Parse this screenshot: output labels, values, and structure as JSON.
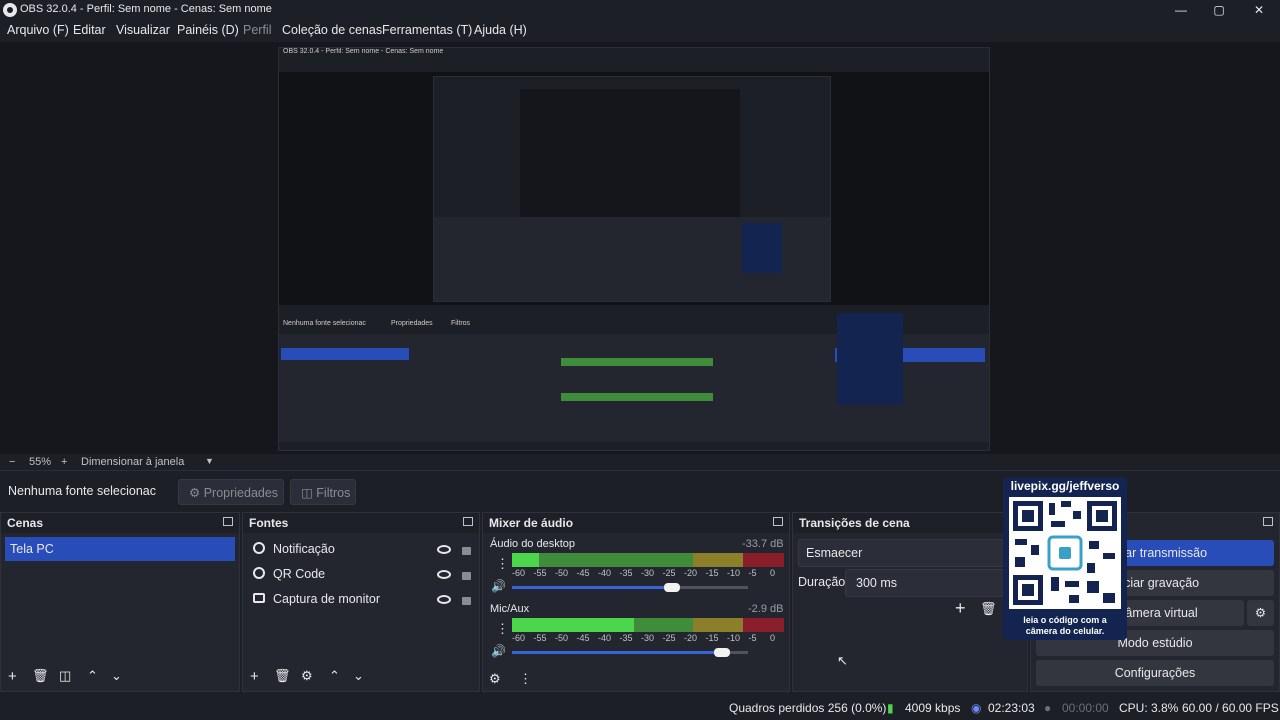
{
  "window": {
    "title": "OBS 32.0.4 - Perfil: Sem nome - Cenas: Sem nome",
    "controls": [
      "minimize-icon",
      "maximize-icon",
      "close-icon"
    ]
  },
  "menu": [
    "Arquivo (F)",
    "Editar",
    "Visualizar",
    "Painéis (D)",
    "Perfil",
    "Coleção de cenas",
    "Ferramentas (T)",
    "Ajuda (H)"
  ],
  "preview": {
    "nested_window_title": "OBS 32.0.4 - Perfil: Sem nome - Cenas: Sem nome",
    "nested_no_source": "Nenhuma fonte selecionac",
    "nested_properties": "Propriedades",
    "nested_filters": "Filtros"
  },
  "zoombar": {
    "minus": "−",
    "zoom": "55%",
    "plus": "+",
    "fit": "Dimensionar à janela"
  },
  "source_toolbar": {
    "status": "Nenhuma fonte selecionac",
    "properties": "Propriedades",
    "filters": "Filtros"
  },
  "scenes": {
    "title": "Cenas",
    "items": [
      "Tela PC"
    ],
    "selected": "Tela PC"
  },
  "sources": {
    "title": "Fontes",
    "items": [
      {
        "label": "Notificação",
        "icon": "browser-icon"
      },
      {
        "label": "QR Code",
        "icon": "browser-icon"
      },
      {
        "label": "Captura de monitor",
        "icon": "monitor-icon"
      }
    ]
  },
  "mixer": {
    "title": "Mixer de áudio",
    "ticks": [
      "-60",
      "-55",
      "-50",
      "-45",
      "-40",
      "-35",
      "-30",
      "-25",
      "-20",
      "-15",
      "-10",
      "-5",
      "0"
    ],
    "channels": [
      {
        "name": "Áudio do desktop",
        "db": "-33.7 dB",
        "level": 0.1,
        "volume": 0.68
      },
      {
        "name": "Mic/Aux",
        "db": "-2.9 dB",
        "level": 0.45,
        "volume": 0.89
      }
    ]
  },
  "transitions": {
    "title": "Transições de cena",
    "selected": "Esmaecer",
    "duration_label": "Duração",
    "duration_value": "300 ms"
  },
  "controls": {
    "start_stream": "Iniciar transmissão",
    "start_recording": "Iniciar gravação",
    "virtual_camera": "Iniciar câmera virtual",
    "studio_mode": "Modo estúdio",
    "settings": "Configurações"
  },
  "overlay": {
    "header": "livepix.gg/jeffverso",
    "footer": "leia o código com a câmera do celular."
  },
  "status": {
    "dropped": "Quadros perdidos 256 (0.0%)",
    "bitrate": "4009 kbps",
    "stream_time": "02:23:03",
    "rec_time": "00:00:00",
    "cpu": "CPU: 3.8%",
    "fps": "60.00 / 60.00 FPS"
  },
  "colors": {
    "accent": "#284cb8",
    "background": "#1d1f26",
    "panel": "#24262f",
    "meter_green": "#4bd64b",
    "meter_red": "#8a1e2a"
  }
}
